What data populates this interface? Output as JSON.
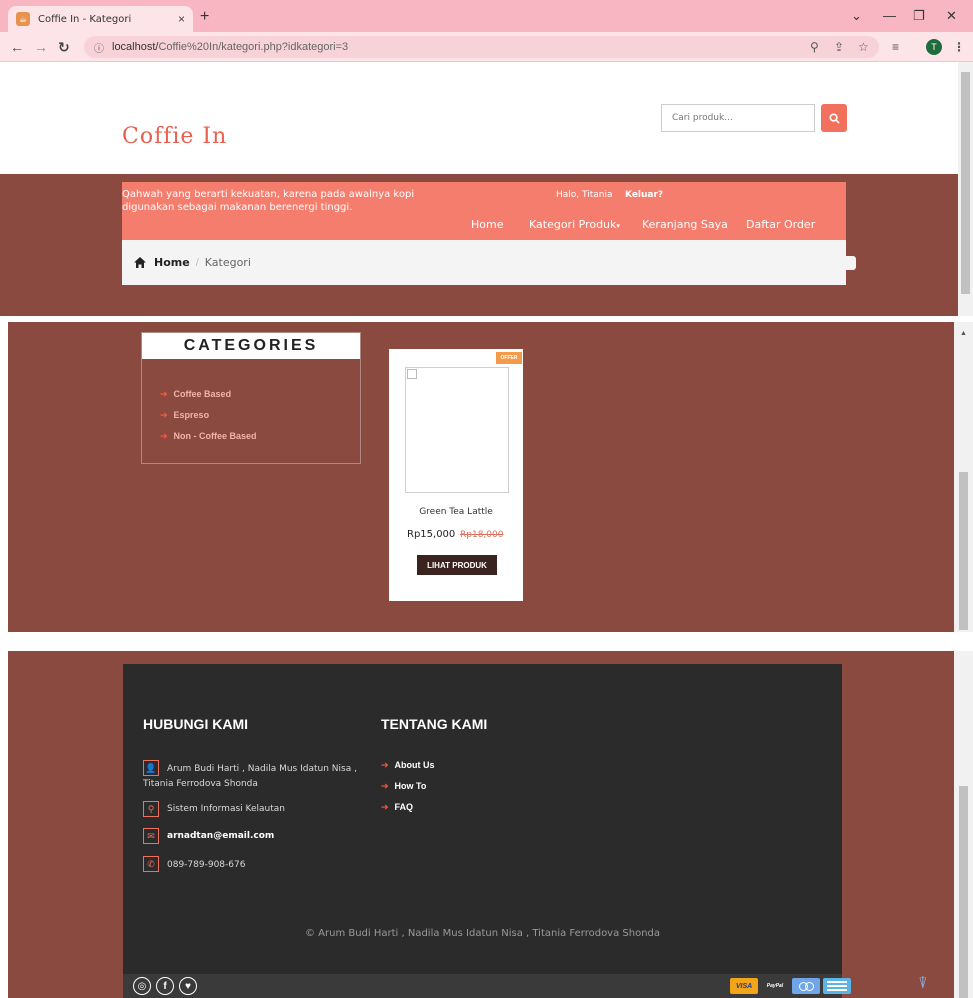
{
  "browser": {
    "tab_title": "Coffie In - Kategori",
    "tab_close": "×",
    "new_tab": "+",
    "url_host": "localhost/",
    "url_path": "Coffie%20In/kategori.php?idkategori=3",
    "profile_initial": "T"
  },
  "header": {
    "logo": "Coffie In",
    "search_placeholder": "Cari produk...",
    "tagline": "Qahwah yang berarti kekuatan, karena pada awalnya kopi digunakan sebagai makanan berenergi tinggi.",
    "greeting": "Halo, Titania",
    "logout": "Keluar?",
    "nav": [
      "Home",
      "Kategori Produk",
      "Keranjang Saya",
      "Daftar Order"
    ]
  },
  "breadcrumb": {
    "home": "Home",
    "separator": "/",
    "current": "Kategori"
  },
  "categories": {
    "title": "CATEGORIES",
    "items": [
      "Coffee Based",
      "Espreso",
      "Non - Coffee Based"
    ]
  },
  "product": {
    "badge": "OFFER",
    "name": "Green Tea Lattle",
    "price": "Rp15,000",
    "old_price": "Rp18,000",
    "button": "LIHAT PRODUK"
  },
  "footer": {
    "contact_title": "HUBUNGI KAMI",
    "about_title": "TENTANG KAMI",
    "contact_names_line1": "Arum Budi Harti , Nadila Mus Idatun Nisa ,",
    "contact_names_line2": "Titania Ferrodova Shonda",
    "address": "Sistem Informasi Kelautan",
    "email": "arnadtan@email.com",
    "phone": "089-789-908-676",
    "links": [
      "About Us",
      "How To",
      "FAQ"
    ],
    "copyright": "© Arum Budi Harti , Nadila Mus Idatun Nisa , Titania Ferrodova Shonda",
    "payments": [
      "VISA",
      "PayPal"
    ]
  },
  "colors": {
    "brand": "#f57d6d",
    "brown": "#8b4a3f",
    "footer_bg": "#2b2b2b",
    "browser_tab": "#f7b6c1"
  }
}
